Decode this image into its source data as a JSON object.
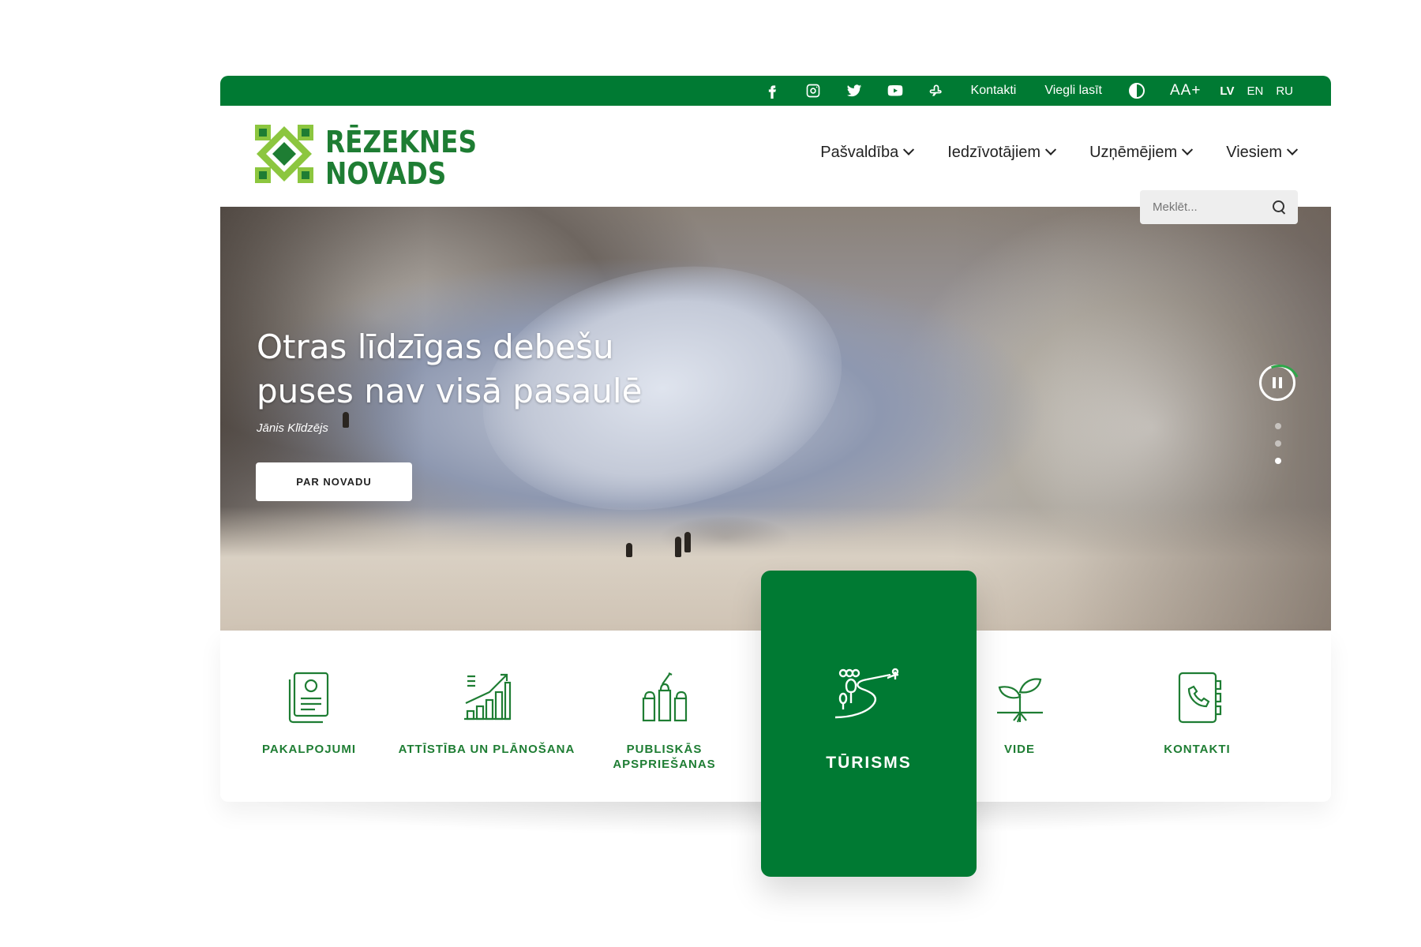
{
  "topbar": {
    "social": [
      "facebook-icon",
      "instagram-icon",
      "twitter-icon",
      "youtube-icon",
      "sign-language-icon"
    ],
    "contacts": "Kontakti",
    "easy_read": "Viegli lasīt",
    "font_size": "AA+",
    "languages": [
      "LV",
      "EN",
      "RU"
    ],
    "active_language": "LV"
  },
  "logo": {
    "line1": "RĒZEKNES",
    "line2": "NOVADS"
  },
  "nav": {
    "items": [
      "Pašvaldība",
      "Iedzīvotājiem",
      "Uzņēmējiem",
      "Viesiem"
    ]
  },
  "search": {
    "placeholder": "Meklēt..."
  },
  "hero": {
    "quote": "Otras līdzīgas debešu puses nav visā pasaulē",
    "author": "Jānis Klīdzējs",
    "button": "PAR NOVADU",
    "slides_total": 3,
    "active_slide": 3
  },
  "services": [
    {
      "label": "PAKALPOJUMI",
      "icon": "document-icon"
    },
    {
      "label": "ATTĪSTĪBA UN PLĀNOŠANA",
      "icon": "growth-chart-icon"
    },
    {
      "label": "PUBLISKĀS APSPRIEŠANAS",
      "icon": "raised-hands-icon"
    },
    {
      "label": "TŪRISMS",
      "icon": "landscape-road-icon",
      "active": true
    },
    {
      "label": "VIDE",
      "icon": "sprout-icon"
    },
    {
      "label": "KONTAKTI",
      "icon": "address-book-icon"
    }
  ],
  "colors": {
    "brand_green": "#007a33",
    "logo_light_green": "#8cc63f"
  }
}
